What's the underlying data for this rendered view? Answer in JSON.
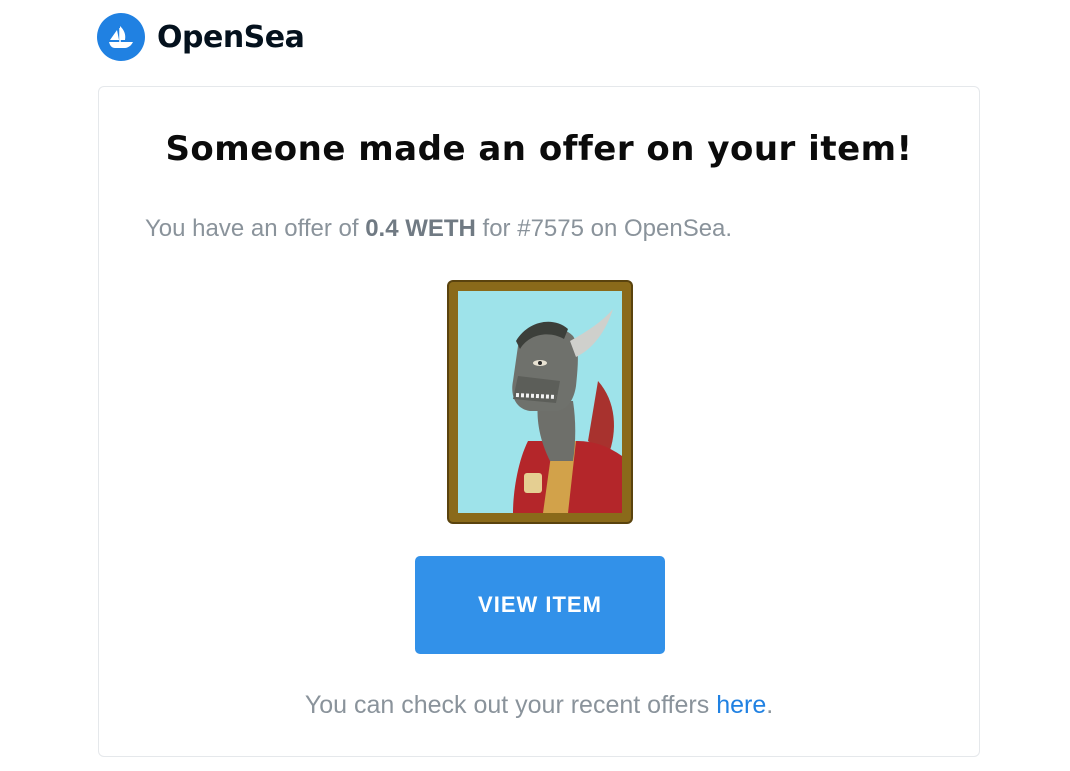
{
  "brand": {
    "name": "OpenSea",
    "logo_icon": "opensea-ship-icon",
    "logo_color": "#2081e2"
  },
  "email": {
    "headline": "Someone made an offer on your item!",
    "offer_prefix": "You have an offer of ",
    "offer_amount": "0.4 WETH",
    "offer_suffix": " for #7575 on OpenSea.",
    "item_image_icon": "dragon-nft-artwork",
    "view_button_label": "VIEW ITEM",
    "button_color": "#3291e9",
    "footer_prefix": "You can check out your recent offers ",
    "footer_link": "here",
    "footer_suffix": "."
  }
}
